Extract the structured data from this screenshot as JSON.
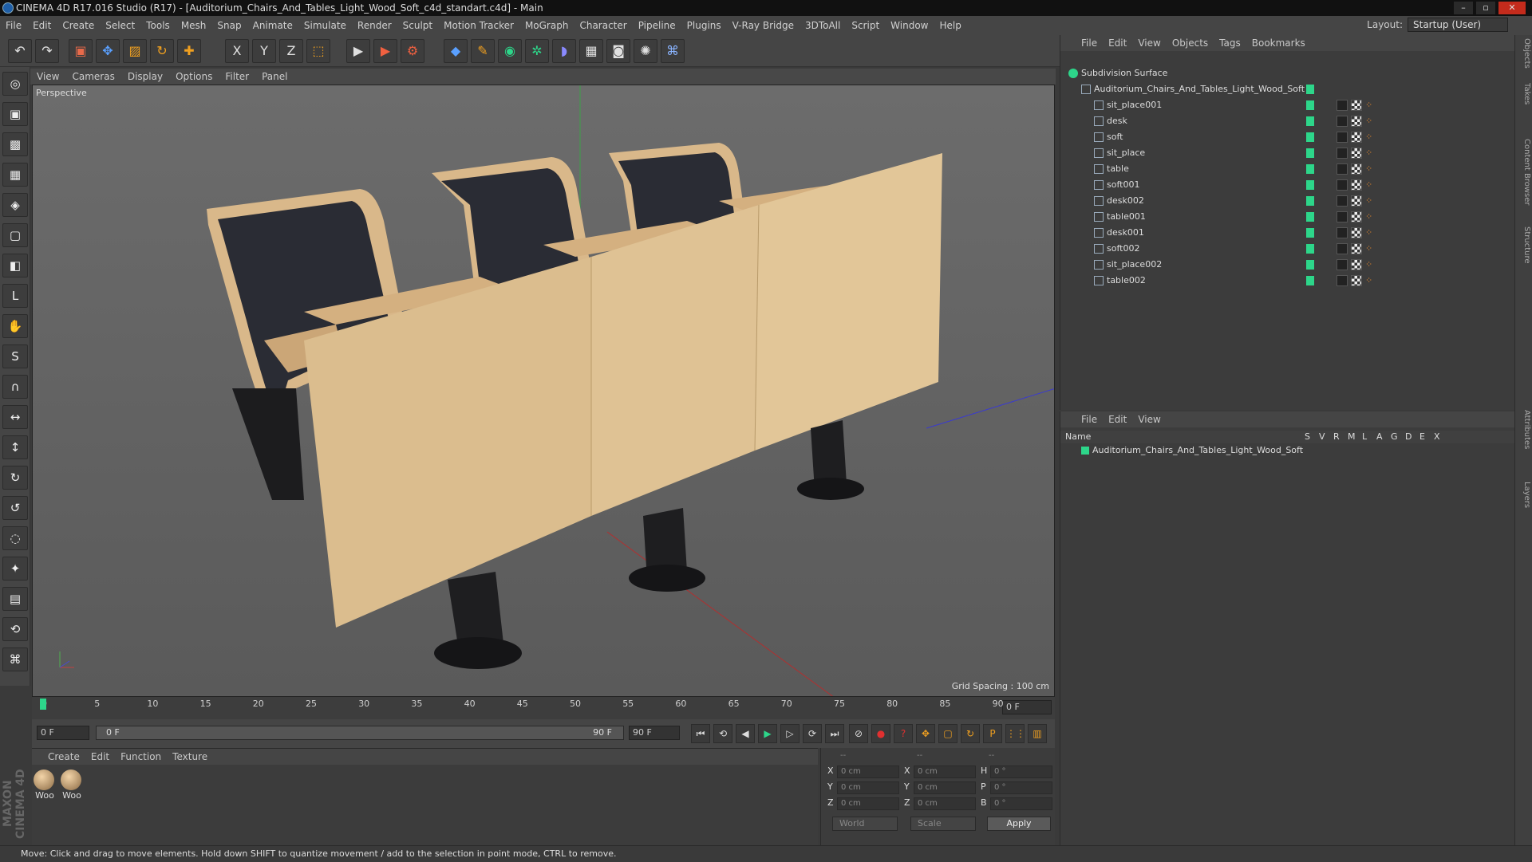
{
  "window": {
    "title": "CINEMA 4D R17.016 Studio (R17) - [Auditorium_Chairs_And_Tables_Light_Wood_Soft_c4d_standart.c4d] - Main",
    "layout_label": "Layout:",
    "layout_value": "Startup (User)"
  },
  "menu": [
    "File",
    "Edit",
    "Create",
    "Select",
    "Tools",
    "Mesh",
    "Snap",
    "Animate",
    "Simulate",
    "Render",
    "Sculpt",
    "Motion Tracker",
    "MoGraph",
    "Character",
    "Pipeline",
    "Plugins",
    "V-Ray Bridge",
    "3DToAll",
    "Script",
    "Window",
    "Help"
  ],
  "toolbar": {
    "undo": "↶",
    "redo": "↷",
    "live_select": "▣",
    "move": "✥",
    "scale": "▨",
    "rotate": "↻",
    "add": "✚",
    "axis_x": "X",
    "axis_y": "Y",
    "axis_z": "Z",
    "coord_system": "⬚",
    "render_view": "▶",
    "render": "▶",
    "render_settings": "⚙",
    "cube": "◆",
    "pen": "✎",
    "subdivision": "◉",
    "array": "✲",
    "deformer": "◗",
    "floor": "▦",
    "camera": "◙",
    "light": "✺",
    "python": "⌘"
  },
  "left_tools": [
    "◎",
    "▣",
    "▩",
    "▦",
    "◈",
    "▢",
    "◧",
    "L",
    "✋",
    "S",
    "∩",
    "↔",
    "↕",
    "↻",
    "↺",
    "◌",
    "✦",
    "▤",
    "⟲",
    "⌘"
  ],
  "viewport": {
    "menu": [
      "View",
      "Cameras",
      "Display",
      "Options",
      "Filter",
      "Panel"
    ],
    "label": "Perspective",
    "grid_spacing": "Grid Spacing : 100 cm"
  },
  "timeline": {
    "ticks": [
      "0",
      "5",
      "10",
      "15",
      "20",
      "25",
      "30",
      "35",
      "40",
      "45",
      "50",
      "55",
      "60",
      "65",
      "70",
      "75",
      "80",
      "85",
      "90"
    ],
    "current_frame": "0 F",
    "start_field": "0 F",
    "range_start": "0 F",
    "range_end": "90 F",
    "end_field": "90 F"
  },
  "transport": [
    "⏮",
    "⟲",
    "◀",
    "▶",
    "▷",
    "⟳",
    "⏭"
  ],
  "transport_keys": [
    "⊘",
    "●",
    "?",
    "✥",
    "▢",
    "↻",
    "P",
    "⋮⋮",
    "▥"
  ],
  "materials": {
    "menu": [
      "Create",
      "Edit",
      "Function",
      "Texture"
    ],
    "items": [
      "Woo",
      "Woo"
    ]
  },
  "coords": {
    "headers": [
      "--",
      "--",
      "--"
    ],
    "rows": [
      {
        "a": "X",
        "v1": "0 cm",
        "b": "X",
        "v2": "0 cm",
        "c": "H",
        "v3": "0 °"
      },
      {
        "a": "Y",
        "v1": "0 cm",
        "b": "Y",
        "v2": "0 cm",
        "c": "P",
        "v3": "0 °"
      },
      {
        "a": "Z",
        "v1": "0 cm",
        "b": "Z",
        "v2": "0 cm",
        "c": "B",
        "v3": "0 °"
      }
    ],
    "world": "World",
    "scale": "Scale",
    "apply": "Apply"
  },
  "objects": {
    "menu": [
      "File",
      "Edit",
      "View",
      "Objects",
      "Tags",
      "Bookmarks"
    ],
    "root": "Subdivision Surface",
    "group": "Auditorium_Chairs_And_Tables_Light_Wood_Soft",
    "children": [
      "sit_place001",
      "desk",
      "soft",
      "sit_place",
      "table",
      "soft001",
      "desk002",
      "table001",
      "desk001",
      "soft002",
      "sit_place002",
      "table002"
    ]
  },
  "layers": {
    "menu": [
      "File",
      "Edit",
      "View"
    ],
    "headers": [
      "Name",
      "S",
      "V",
      "R",
      "M",
      "L",
      "A",
      "G",
      "D",
      "E",
      "X"
    ],
    "row": "Auditorium_Chairs_And_Tables_Light_Wood_Soft"
  },
  "right_tabs": [
    "Objects",
    "Takes",
    "Content Browser",
    "Structure",
    "Attributes",
    "Layers"
  ],
  "status": "Move: Click and drag to move elements. Hold down SHIFT to quantize movement / add to the selection in point mode, CTRL to remove.",
  "brand": "MAXON CINEMA 4D",
  "colors": {
    "accent": "#2dd68a",
    "wood": "#d9b88a",
    "seat": "#2a2c34"
  }
}
